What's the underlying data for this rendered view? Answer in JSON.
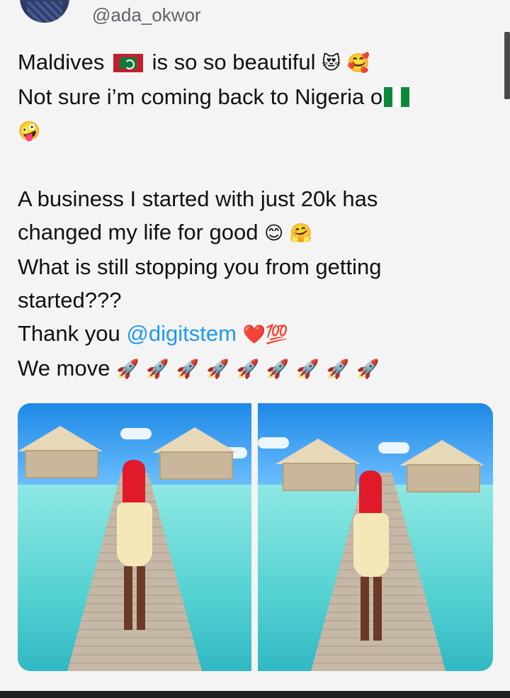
{
  "post": {
    "handle": "@ada_okwor",
    "lines": [
      {
        "text": "Maldives",
        "after_flag": " is so so beautiful",
        "emojis": "😻 🥰"
      },
      {
        "text": "Not sure i’m coming back to Nigeria o",
        "emojis": ""
      },
      {
        "text": "",
        "emojis": "🤪"
      },
      {
        "text": "A business I started with just 20k has"
      },
      {
        "text": "changed my life for good",
        "emojis": "😊 🤗"
      },
      {
        "text": "What is still stopping you from getting"
      },
      {
        "text": "started???"
      },
      {
        "text": "Thank you ",
        "mention": "@digitstem",
        "emojis": "❤️💯"
      },
      {
        "text": "We move ",
        "rockets": "🚀🚀🚀🚀🚀🚀🚀🚀🚀"
      }
    ]
  },
  "icons": {
    "maldives_flag": "maldives-flag-icon",
    "nigeria_flag": "nigeria-flag-icon"
  },
  "colors": {
    "mention": "#1d9bf0",
    "handle": "#5f6368",
    "background": "#f4f4f4"
  },
  "media": {
    "count": 2
  }
}
